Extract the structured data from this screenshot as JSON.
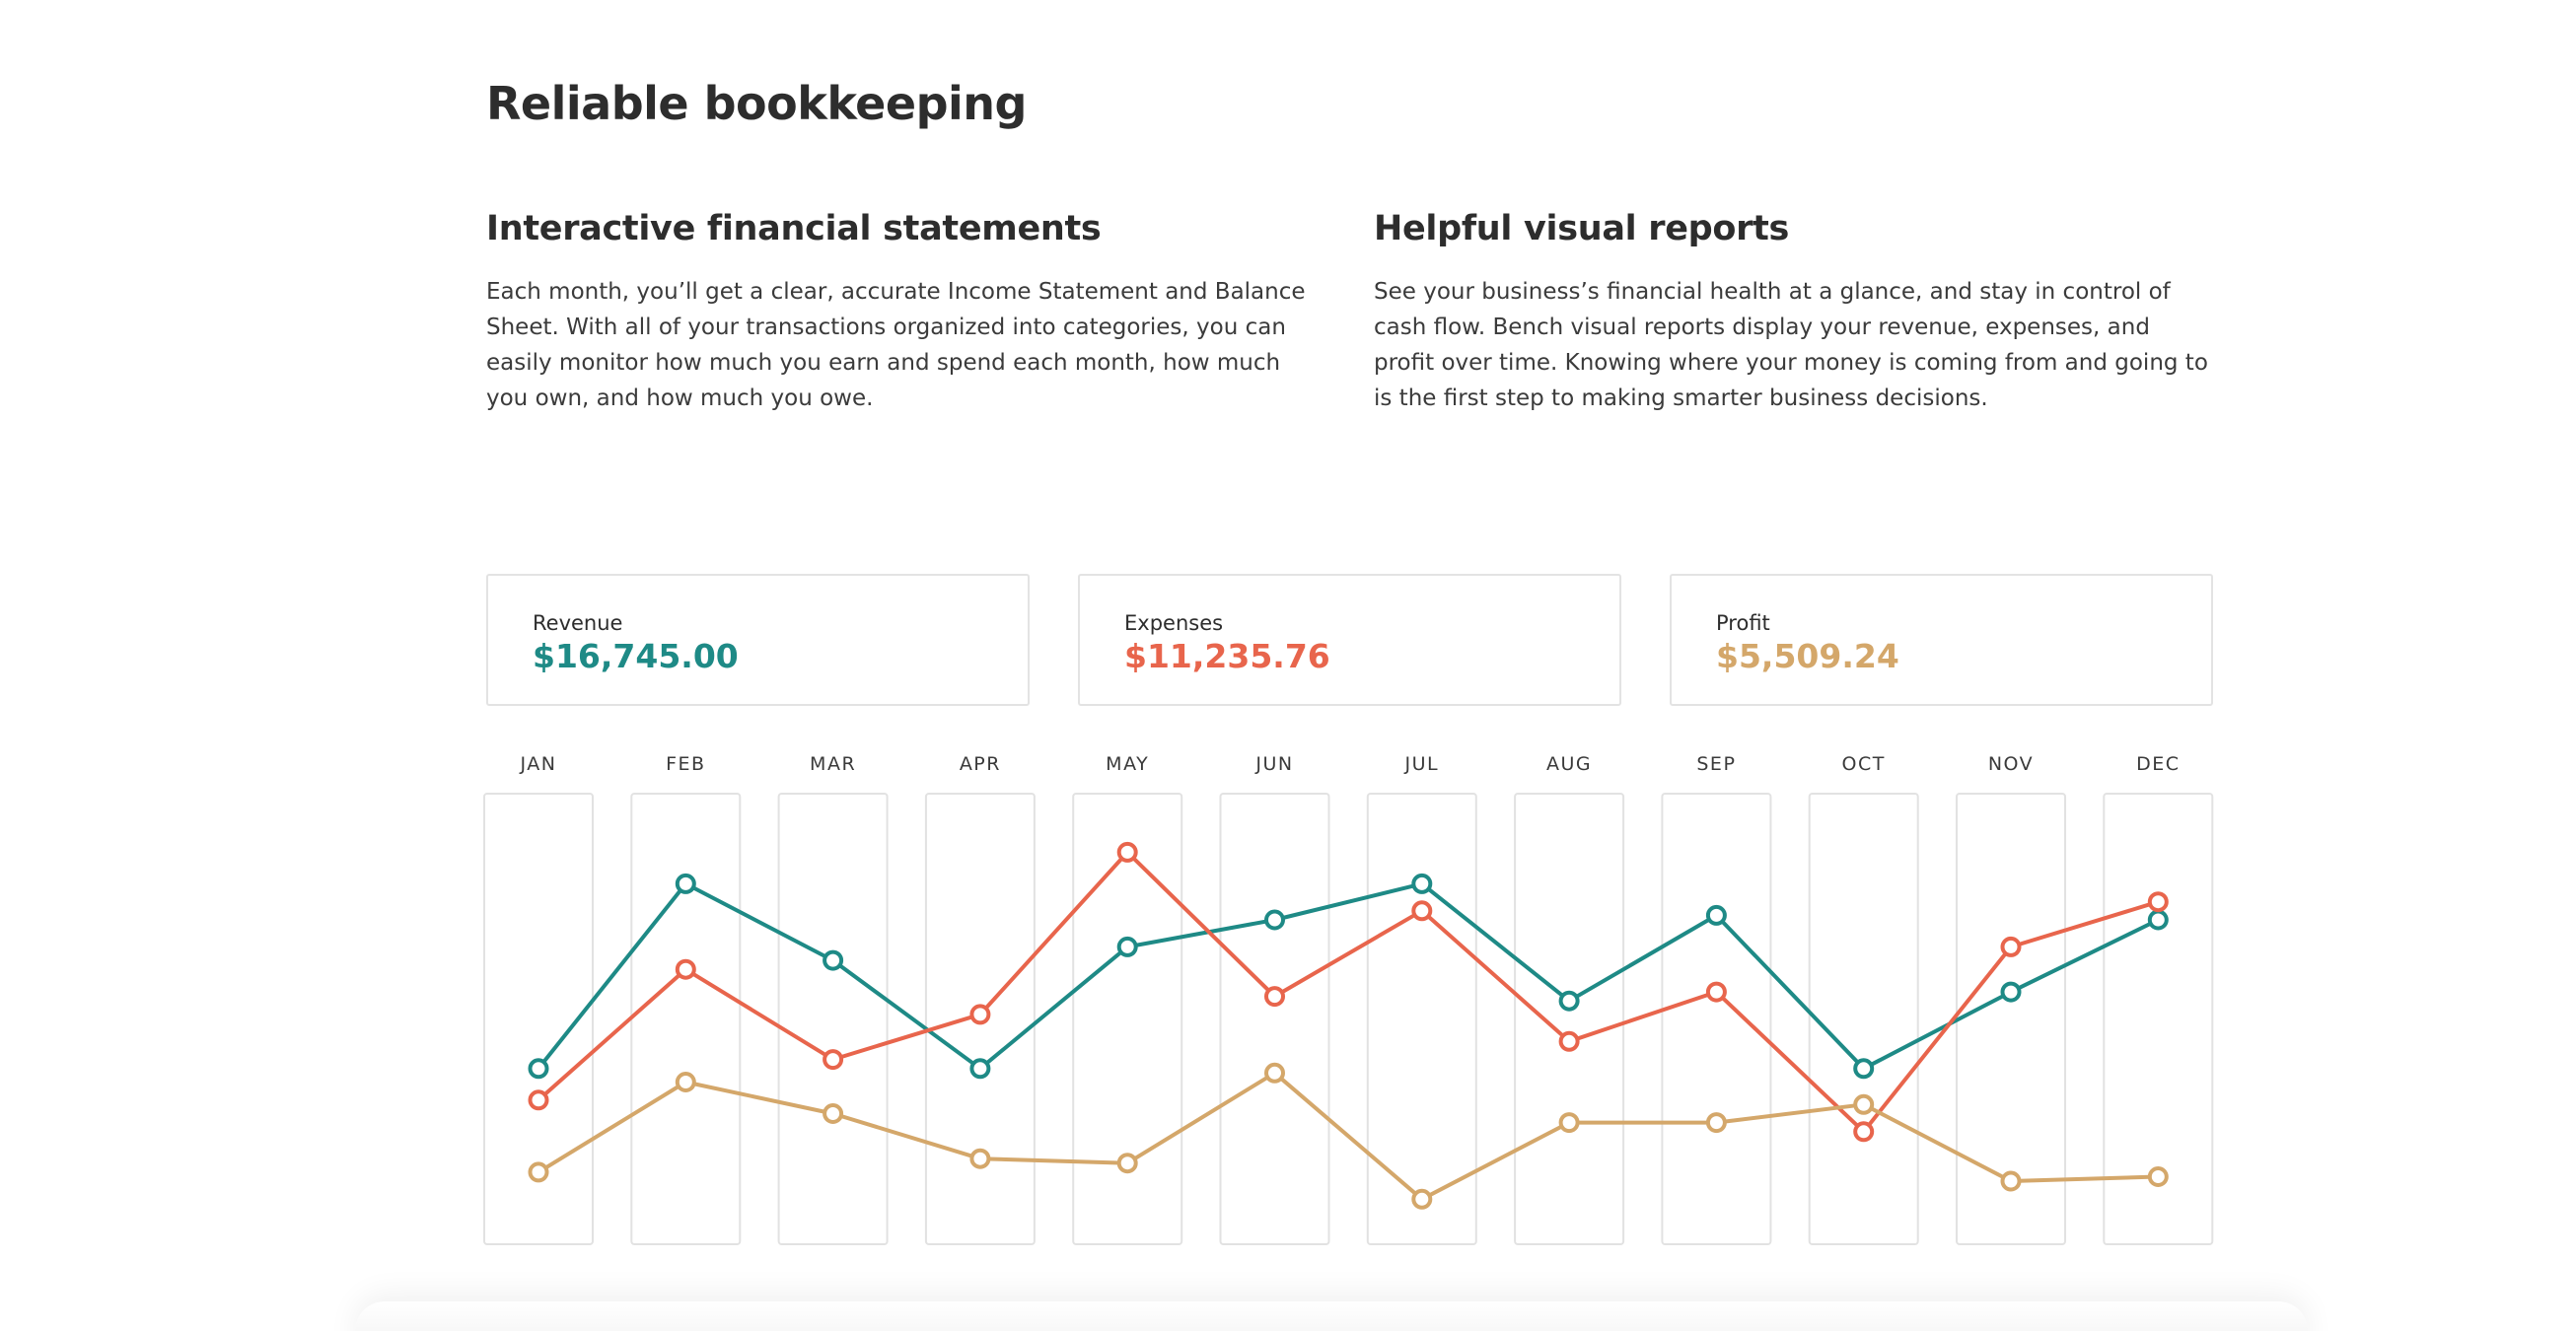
{
  "page": {
    "title": "Reliable bookkeeping",
    "sections": [
      {
        "heading": "Interactive financial statements",
        "body": "Each month, you’ll get a clear, accurate Income Statement and Balance Sheet. With all of your transactions organized into categories, you can easily monitor how much you earn and spend each month, how much you own, and how much you owe."
      },
      {
        "heading": "Helpful visual reports",
        "body": "See your business’s financial health at a glance, and stay in control of cash flow. Bench visual reports display your revenue, expenses, and profit over time. Knowing where your money is coming from and going to is the first step to making smarter business decisions."
      }
    ]
  },
  "summary": {
    "revenue": {
      "label": "Revenue",
      "value": "$16,745.00",
      "color": "#1e8a86"
    },
    "expenses": {
      "label": "Expenses",
      "value": "$11,235.76",
      "color": "#e8654c"
    },
    "profit": {
      "label": "Profit",
      "value": "$5,509.24",
      "color": "#d4a76a"
    }
  },
  "chart_data": {
    "type": "line",
    "categories": [
      "JAN",
      "FEB",
      "MAR",
      "APR",
      "MAY",
      "JUN",
      "JUL",
      "AUG",
      "SEP",
      "OCT",
      "NOV",
      "DEC"
    ],
    "series": [
      {
        "name": "Revenue",
        "color": "#1e8a86",
        "values": [
          39,
          80,
          63,
          39,
          66,
          72,
          80,
          54,
          73,
          39,
          56,
          72
        ]
      },
      {
        "name": "Expenses",
        "color": "#e8654c",
        "values": [
          32,
          61,
          41,
          51,
          87,
          55,
          74,
          45,
          56,
          25,
          66,
          76
        ]
      },
      {
        "name": "Profit",
        "color": "#d4a76a",
        "values": [
          16,
          36,
          29,
          19,
          18,
          38,
          10,
          27,
          27,
          31,
          14,
          15
        ]
      }
    ],
    "ylim": [
      0,
      100
    ],
    "grid": false
  }
}
